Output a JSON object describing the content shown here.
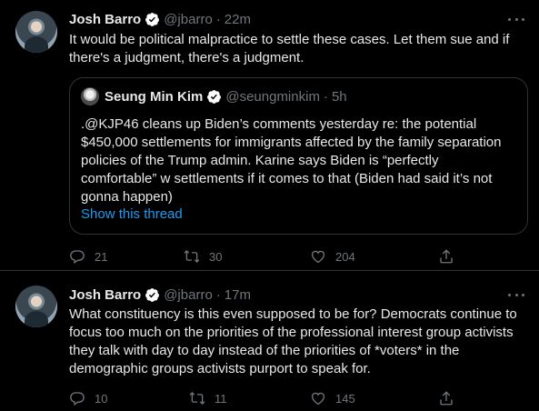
{
  "colors": {
    "background": "#000000",
    "text": "#e7e9ea",
    "secondary": "#71767b",
    "link": "#1d9bf0",
    "verified": "#ffffff",
    "border": "#2f3336"
  },
  "tweets": [
    {
      "name": "Josh Barro",
      "handle": "@jbarro",
      "dot": "·",
      "time": "22m",
      "text": "It would be political malpractice to settle these cases. Let them sue and if there's a judgment, there's a judgment.",
      "quote": {
        "name": "Seung Min Kim",
        "handle": "@seungminkim",
        "dot": "·",
        "time": "5h",
        "text": ".@KJP46 cleans up Biden’s comments yesterday re: the potential $450,000 settlements for immigrants affected by the family separation policies of the Trump admin. Karine says Biden is “perfectly comfortable” w settlements if it comes to that (Biden had said it’s not gonna happen)",
        "show_thread": "Show this thread"
      },
      "replies": "21",
      "retweets": "30",
      "likes": "204"
    },
    {
      "name": "Josh Barro",
      "handle": "@jbarro",
      "dot": "·",
      "time": "17m",
      "text": "What constituency is this even supposed to be for? Democrats continue to focus too much on the priorities of the professional interest group activists they talk with day to day instead of the priorities of *voters* in the demographic groups activists purport to speak for.",
      "replies": "10",
      "retweets": "11",
      "likes": "145"
    }
  ],
  "icons": {
    "verified": "verified-badge-icon",
    "more": "more-options-icon",
    "reply": "reply-icon",
    "retweet": "retweet-icon",
    "like": "heart-icon",
    "share": "share-icon"
  }
}
